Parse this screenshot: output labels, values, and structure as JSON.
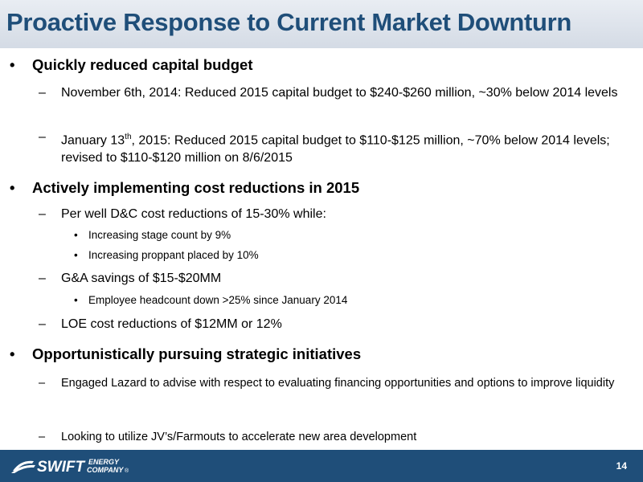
{
  "slide": {
    "title": "Proactive Response to Current Market Downturn",
    "page_number": "14"
  },
  "bullets": [
    {
      "text": "Quickly reduced capital budget",
      "subitems": [
        {
          "text": "November 6th, 2014: Reduced 2015 capital budget to $240-$260 million, ~30% below 2014 levels"
        },
        {
          "text_before": "January 13",
          "superscript": "th",
          "text_after": ", 2015: Reduced 2015 capital budget to $110-$125 million, ~70% below 2014 levels; revised to $110-$120 million on 8/6/2015"
        }
      ]
    },
    {
      "text": "Actively implementing cost reductions in 2015",
      "subitems": [
        {
          "text": "Per well D&C cost reductions of 15-30% while:",
          "subitems": [
            "Increasing stage count by 9%",
            "Increasing proppant placed by 10%"
          ]
        },
        {
          "text": "G&A savings of $15-$20MM",
          "subitems": [
            "Employee headcount down >25% since January 2014"
          ]
        },
        {
          "text": "LOE cost reductions of $12MM or 12%"
        }
      ]
    },
    {
      "text": "Opportunistically pursuing strategic initiatives",
      "subitems": [
        {
          "text": "Engaged Lazard to advise with respect to evaluating financing opportunities and options to improve liquidity"
        },
        {
          "text": "Looking to utilize JV’s/Farmouts to accelerate new area development"
        }
      ]
    }
  ],
  "markers": {
    "level1": "•",
    "level2": "–",
    "level3": "•"
  },
  "logo": {
    "word1": "SWIFT",
    "word2": "ENERGY",
    "word3": "COMPANY",
    "registered": "®"
  },
  "colors": {
    "title": "#1f4e79",
    "footer": "#1f4e79",
    "title_bar_top": "#e9edf3",
    "title_bar_bottom": "#d4dbe5"
  }
}
